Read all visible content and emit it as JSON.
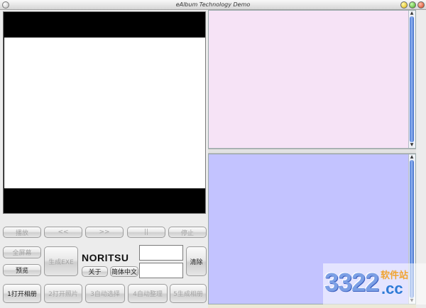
{
  "window": {
    "title": "eAlbum Technology Demo"
  },
  "playback": {
    "play": "播放",
    "rewind": "<<",
    "forward": ">>",
    "pause": "||",
    "stop": "停止"
  },
  "controls": {
    "fullscreen": "全屏幕",
    "preview": "预览",
    "generate_exe": "生成EXE",
    "brand": "NORITSU",
    "about": "关于",
    "language": "简体中文",
    "clear": "清除",
    "field_top_value": "",
    "field_bottom_value": ""
  },
  "steps": [
    {
      "label": "1打开相册",
      "enabled": true
    },
    {
      "label": "2打开照片",
      "enabled": false
    },
    {
      "label": "3自动选择",
      "enabled": false
    },
    {
      "label": "4自动整理",
      "enabled": false
    },
    {
      "label": "5生成相册",
      "enabled": false
    }
  ],
  "watermark": {
    "number": "3322",
    "site": "软件站",
    "domain": ".cc"
  },
  "colors": {
    "top_pane": "#f6e3f6",
    "bottom_pane": "#c3c3ff",
    "preview_border": "#000000"
  },
  "icons": [
    "app-icon",
    "minimize-icon",
    "maximize-icon",
    "close-icon",
    "scroll-up-icon",
    "scroll-down-icon"
  ]
}
